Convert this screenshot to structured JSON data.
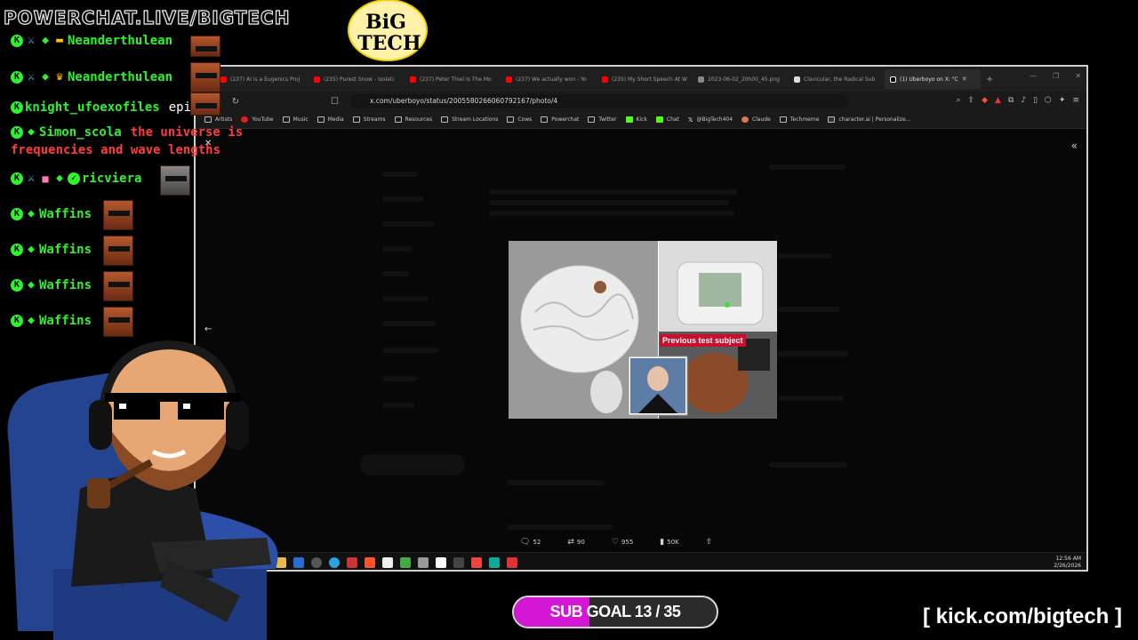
{
  "overlay": {
    "site_title": "POWERCHAT.LIVE/BIGTECH",
    "logo_text_1": "BiG",
    "logo_text_2": "TECH",
    "sub_goal": "SUB GOAL 13 / 35",
    "sub_goal_progress": 0.371,
    "kick_url": "[ kick.com/bigtech ]"
  },
  "chat": {
    "messages": [
      {
        "user": "Neanderthulean",
        "text": ""
      },
      {
        "user": "Neanderthulean",
        "text": ""
      },
      {
        "user": "knight_ufoexofiles",
        "text": "epic"
      },
      {
        "user": "Simon_scola",
        "text": "the universe is",
        "text2": "frequencies and wave lengths"
      },
      {
        "user": "ricviera",
        "text": ""
      },
      {
        "user": "Waffins",
        "text": ""
      },
      {
        "user": "Waffins",
        "text": ""
      },
      {
        "user": "Waffins",
        "text": ""
      },
      {
        "user": "Waffins",
        "text": ""
      }
    ]
  },
  "browser": {
    "tabs": [
      {
        "label": "(237) AI is a Eugenics Proj",
        "color": "#ff0000"
      },
      {
        "label": "(235) Purest Snow - Isolati",
        "color": "#ff0000"
      },
      {
        "label": "(237) Peter Thiel Is The Mo",
        "color": "#ff0000"
      },
      {
        "label": "(237) We actually won - Yo",
        "color": "#ff0000"
      },
      {
        "label": "(235) My Short Speech At W",
        "color": "#ff0000"
      },
      {
        "label": "2023-06-02_20h00_45.png",
        "color": "#888888"
      },
      {
        "label": "Clavicular, the Radical Sub",
        "color": "#dddddd"
      },
      {
        "label": "(1) Uberboyo on X: \"C",
        "color": "#ffffff"
      }
    ],
    "url": "x.com/uberboyo/status/2005580266060792167/photo/4",
    "bookmarks": [
      "Artists",
      "YouTube",
      "Music",
      "Media",
      "Streams",
      "Resources",
      "Stream Locations",
      "Cows",
      "Powerchat",
      "Twitter",
      "Kick",
      "Chat",
      "@BigTech404",
      "Claude",
      "Techmeme",
      "character.ai | Personalize..."
    ],
    "image_caption": "Previous test subject",
    "stats": {
      "replies": "52",
      "reposts": "90",
      "likes": "955",
      "views": "50K"
    },
    "clock_time": "12:56 AM",
    "clock_date": "2/26/2026"
  },
  "colors": {
    "chat_username": "#2ef22e",
    "chat_text": "#ff3b3b",
    "sub_goal_fill": "#d417d4"
  }
}
